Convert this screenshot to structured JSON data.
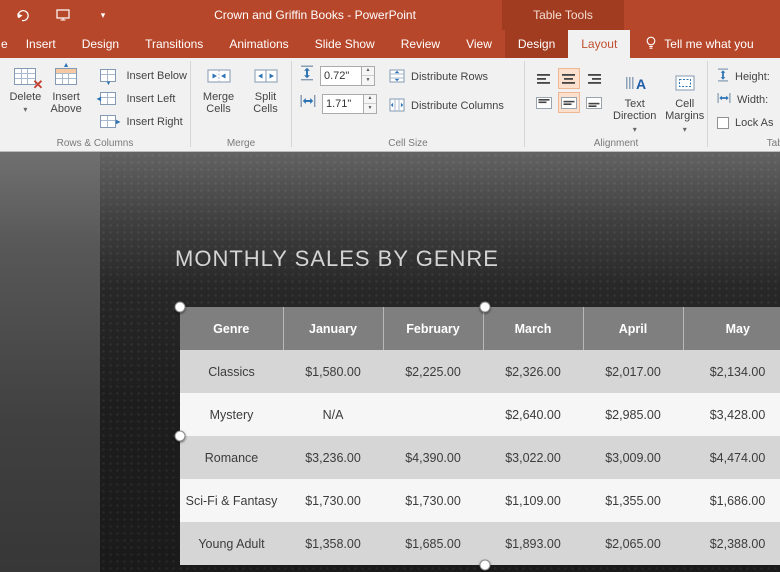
{
  "title_bar": {
    "title": "Crown and Griffin Books - PowerPoint",
    "context_label": "Table Tools"
  },
  "tabs": {
    "file_partial": "e",
    "items": [
      "Insert",
      "Design",
      "Transitions",
      "Animations",
      "Slide Show",
      "Review",
      "View"
    ],
    "contextual": {
      "design": "Design",
      "layout": "Layout"
    },
    "tell_me": "Tell me what you"
  },
  "ribbon": {
    "rows_columns": {
      "group_label": "Rows & Columns",
      "delete": "Delete",
      "insert_above": "Insert Above",
      "insert_below": "Insert Below",
      "insert_left": "Insert Left",
      "insert_right": "Insert Right"
    },
    "merge": {
      "group_label": "Merge",
      "merge_cells": "Merge Cells",
      "split_cells": "Split Cells"
    },
    "cell_size": {
      "group_label": "Cell Size",
      "height_value": "0.72\"",
      "width_value": "1.71\"",
      "distribute_rows": "Distribute Rows",
      "distribute_columns": "Distribute Columns"
    },
    "alignment": {
      "group_label": "Alignment",
      "text_direction": "Text Direction",
      "cell_margins": "Cell Margins"
    },
    "table_size": {
      "group_label": "Tabl",
      "height_label": "Height:",
      "width_label": "Width:",
      "lock_aspect_label": "Lock As"
    }
  },
  "slide": {
    "title": "MONTHLY SALES BY GENRE",
    "table": {
      "headers": [
        "Genre",
        "January",
        "February",
        "March",
        "April",
        "May"
      ],
      "rows": [
        [
          "Classics",
          "$1,580.00",
          "$2,225.00",
          "$2,326.00",
          "$2,017.00",
          "$2,134.00"
        ],
        [
          "Mystery",
          "N/A",
          "",
          "$2,640.00",
          "$2,985.00",
          "$3,428.00"
        ],
        [
          "Romance",
          "$3,236.00",
          "$4,390.00",
          "$3,022.00",
          "$3,009.00",
          "$4,474.00"
        ],
        [
          "Sci-Fi & Fantasy",
          "$1,730.00",
          "$1,730.00",
          "$1,109.00",
          "$1,355.00",
          "$1,686.00"
        ],
        [
          "Young Adult",
          "$1,358.00",
          "$1,685.00",
          "$1,893.00",
          "$2,065.00",
          "$2,388.00"
        ]
      ]
    }
  },
  "colors": {
    "titlebar": "#B7472A",
    "context_patch": "#A23C20",
    "ribbon_bg": "#F1F1F1",
    "active_tab_text": "#C0502F",
    "table_header_bg": "#7F7F7F",
    "row_band_dark": "#D6D6D6",
    "row_band_light": "#F6F6F6",
    "slide_bg": "#1F1F1F"
  }
}
